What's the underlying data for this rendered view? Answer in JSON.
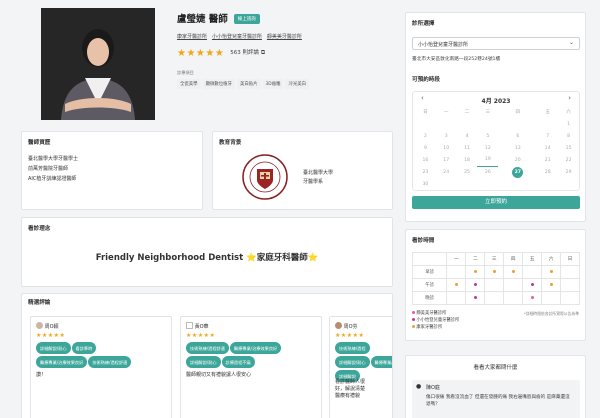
{
  "doctor": {
    "name": "盧瑩婕 醫師",
    "badge": "線上諮詢",
    "clinics": [
      "康家牙醫診所",
      "小小怡登兒童牙醫診所",
      "靜美美牙醫診所"
    ],
    "rating_stars": "★★★★★",
    "rating_count": "563 則評論",
    "services_label": "診療項目",
    "services": [
      "全瓷美學",
      "顯微數位植牙",
      "美白貼片",
      "3D齒雕",
      "冷光美白"
    ]
  },
  "qualifications": {
    "title": "醫師資歷",
    "items": [
      "臺北醫學大學牙醫學士",
      "前萬芳醫院牙醫師",
      "AIC植牙訓練認證醫師"
    ]
  },
  "education": {
    "title": "教育背景",
    "school": "臺北醫學大學",
    "dept": "牙醫學系"
  },
  "philosophy": {
    "title": "看診理念",
    "text": "Friendly Neighborhood Dentist ⭐家庭牙科醫師⭐"
  },
  "reviews": {
    "title": "精選評論",
    "items": [
      {
        "author": "周O穎",
        "stars": "★★★★★",
        "tags": [
          "詳細解說/耐心",
          "看診準時",
          "醫療專業/治療效果良好",
          "技術熟練/過程舒適"
        ],
        "text": "讚！"
      },
      {
        "author": "黃O華",
        "stars": "★★★★★",
        "tags": [
          "技術熟練/過程舒適",
          "醫療專業/治療效果良好",
          "詳細解說/耐心",
          "診療過程不痛"
        ],
        "text": "醫師親切又有禮貌讓人很安心"
      },
      {
        "author": "周O芬",
        "stars": "★★★★★",
        "tags": [
          "技術熟練/過程",
          "詳細解說/耐心",
          "醫療專業/治療",
          "詳細解說"
        ],
        "text": "看診醫師人很好，解說清楚醫療有禮貌"
      }
    ]
  },
  "booking": {
    "clinic_label": "診所選擇",
    "clinic_value": "小小怡登兒童牙醫診所",
    "address": "臺北市大安區敦化南路一段252巷24號1樓",
    "time_label": "可預約時段",
    "month": "4月 2023",
    "weekdays": [
      "日",
      "一",
      "二",
      "三",
      "四",
      "五",
      "六"
    ],
    "weeks": [
      [
        "26",
        "27",
        "28",
        "29",
        "30",
        "31",
        "1"
      ],
      [
        "2",
        "3",
        "4",
        "5",
        "6",
        "7",
        "8"
      ],
      [
        "9",
        "10",
        "11",
        "12",
        "13",
        "14",
        "15"
      ],
      [
        "16",
        "17",
        "18",
        "19",
        "20",
        "21",
        "22"
      ],
      [
        "23",
        "24",
        "25",
        "26",
        "27",
        "28",
        "29"
      ],
      [
        "30",
        "",
        "",
        "",
        "",
        "",
        ""
      ]
    ],
    "selected_day": "27",
    "book_button": "立即預約"
  },
  "schedule": {
    "title": "看診時間",
    "days": [
      "一",
      "二",
      "三",
      "四",
      "五",
      "六",
      "日"
    ],
    "rows": [
      "早診",
      "午診",
      "晚診"
    ],
    "note": "*詳細時間依各診所實際公告為準",
    "legend": [
      "靜美美牙醫診所",
      "小小怡登兒童牙醫診所",
      "康家牙醫診所"
    ]
  },
  "qa": {
    "title": "看看大家都問什麼",
    "author": "陳O庭",
    "question": "傷口很痛 我看沒流血了 但還在發腫的痛 我右邊嘴唇與齒的 是麻藥還沒退嗎？"
  },
  "colors": {
    "accent": "#3da69a",
    "star": "#f2a619"
  }
}
